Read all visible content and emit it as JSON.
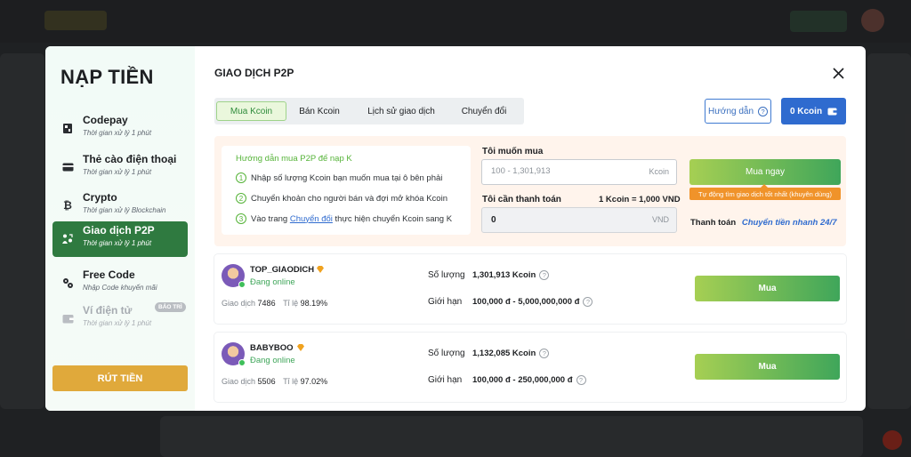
{
  "sidebar": {
    "title": "NẠP TIỀN",
    "items": [
      {
        "label": "Codepay",
        "sub": "Thời gian xử lý 1 phút",
        "icon": "codepay-icon"
      },
      {
        "label": "Thẻ cào điện thoại",
        "sub": "Thời gian xử lý 1 phút",
        "icon": "card-icon"
      },
      {
        "label": "Crypto",
        "sub": "Thời gian xử lý Blockchain",
        "icon": "bitcoin-icon"
      },
      {
        "label": "Giao dịch P2P",
        "sub": "Thời gian xử lý 1 phút",
        "icon": "p2p-icon"
      },
      {
        "label": "Free Code",
        "sub": "Nhập Code khuyến mãi",
        "icon": "gift-icon"
      },
      {
        "label": "Ví điện tử",
        "sub": "Thời gian xử lý 1 phút",
        "icon": "wallet-icon",
        "badge": "BẢO TRÌ"
      }
    ],
    "withdraw_label": "RÚT TIỀN"
  },
  "main": {
    "title": "GIAO DỊCH P2P",
    "tabs": [
      {
        "label": "Mua Kcoin"
      },
      {
        "label": "Bán Kcoin"
      },
      {
        "label": "Lịch sử giao dịch"
      },
      {
        "label": "Chuyển đổi"
      }
    ],
    "guide_label": "Hướng dẫn",
    "balance_label": "0 Kcoin"
  },
  "buy_panel": {
    "instructions_title": "Hướng dẫn mua P2P để nạp K",
    "steps": [
      {
        "num": "1",
        "text": "Nhập số lượng Kcoin bạn muốn mua tại ô bên phải"
      },
      {
        "num": "2",
        "text": "Chuyển khoản cho người bán và đợi mở khóa Kcoin"
      },
      {
        "num": "3",
        "pre": "Vào trang ",
        "link": "Chuyển đổi",
        "post": " thực hiện chuyển Kcoin sang K"
      }
    ],
    "want_buy_label": "Tôi muốn mua",
    "want_buy_placeholder": "100 - 1,301,913",
    "want_buy_unit": "Kcoin",
    "need_pay_label": "Tôi cần thanh toán",
    "rate": "1 Kcoin = 1,000 VND",
    "pay_value": "0",
    "pay_unit": "VND",
    "buy_now_label": "Mua ngay",
    "auto_tag": "Tự động tìm giao dịch tốt nhất (khuyên dùng)",
    "pay_method_label": "Thanh toán",
    "pay_method_value": "Chuyển tiền nhanh 24/7"
  },
  "sellers": [
    {
      "name": "TOP_GIAODICH",
      "status": "Đang online",
      "trades_label": "Giao dịch",
      "trades": "7486",
      "rate_label": "Tỉ lệ",
      "rate": "98.19%",
      "qty_label": "Số lượng",
      "qty": "1,301,913 Kcoin",
      "limit_label": "Giới hạn",
      "limit": "100,000 đ - 5,000,000,000 đ",
      "buy_label": "Mua"
    },
    {
      "name": "BABYBOO",
      "status": "Đang online",
      "trades_label": "Giao dịch",
      "trades": "5506",
      "rate_label": "Tỉ lệ",
      "rate": "97.02%",
      "qty_label": "Số lượng",
      "qty": "1,132,085 Kcoin",
      "limit_label": "Giới hạn",
      "limit": "100,000 đ - 250,000,000 đ",
      "buy_label": "Mua"
    }
  ],
  "colors": {
    "active_green": "#2f7a40",
    "accent_blue": "#2f6bcf",
    "withdraw_gold": "#e0a93b",
    "tag_orange": "#f0932a"
  }
}
